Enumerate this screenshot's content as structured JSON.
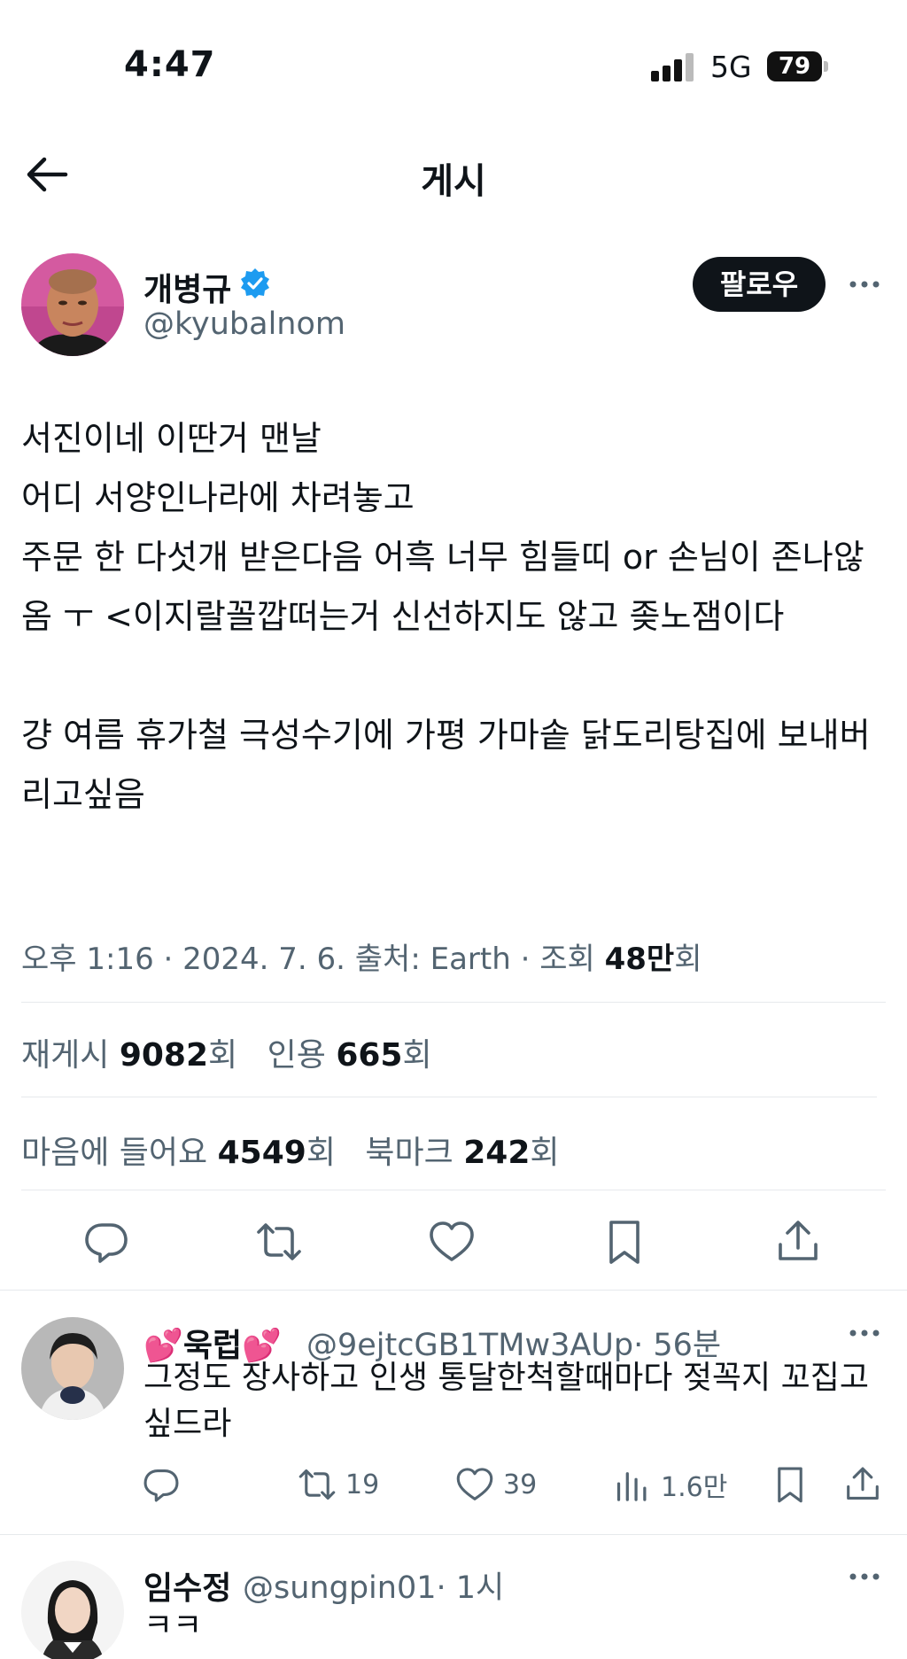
{
  "status_bar": {
    "time": "4:47",
    "network": "5G",
    "battery": "79"
  },
  "nav": {
    "title": "게시",
    "back_icon": "arrow-left-icon"
  },
  "post": {
    "author_name": "개병규",
    "author_handle": "@kyubalnom",
    "verified": true,
    "follow_label": "팔로우",
    "text": "서진이네 이딴거 맨날\n어디 서양인나라에 차려놓고\n주문 한 다섯개 받은다음 어흑 너무 힘들띠 or 손님이 존나않옴 ㅜ <이지랄꼴깝떠는거 신선하지도 않고 좆노잼이다\n\n걍 여름 휴가철 극성수기에 가평 가마솥 닭도리탕집에 보내버리고싶음",
    "meta_prefix": "오후 1:16 · 2024. 7. 6. 출처: Earth · 조회 ",
    "views": "48만",
    "views_suffix": "회"
  },
  "stats": {
    "reposts_label": "재게시",
    "reposts": "9082",
    "reposts_suffix": "회",
    "quotes_label": "인용",
    "quotes": "665",
    "quotes_suffix": "회",
    "likes_label": "마음에 들어요",
    "likes": "4549",
    "likes_suffix": "회",
    "bookmarks_label": "북마크",
    "bookmarks": "242",
    "bookmarks_suffix": "회"
  },
  "replies": [
    {
      "name": "💕욱럽💕",
      "handle": "@9ejtcGB1TMw3AUp",
      "time": "· 56분",
      "text": "그정도 장사하고 인생 통달한척할때마다 젖꼭지 꼬집고 싶드라",
      "reposts": "19",
      "likes": "39",
      "views": "1.6만"
    },
    {
      "name": "임수정",
      "handle": "@sungpin01",
      "time": "· 1시",
      "text": "ㅋㅋ"
    }
  ],
  "colors": {
    "accent": "#1d9bf0",
    "text": "#0f1419",
    "secondary": "#536471"
  }
}
